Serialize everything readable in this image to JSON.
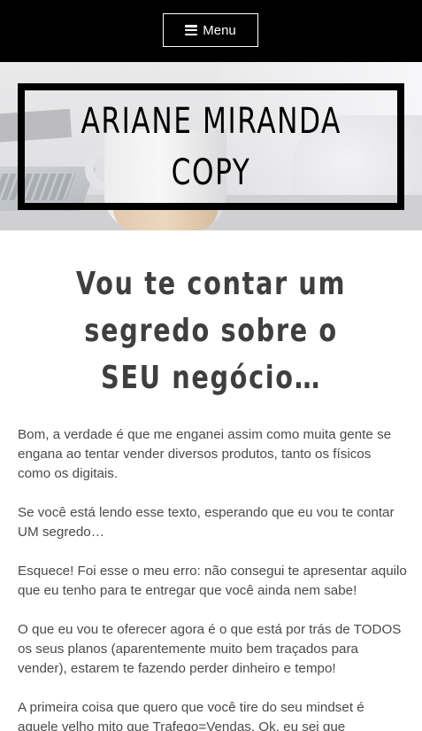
{
  "header": {
    "menu_label": "Menu",
    "menu_icon": "hamburger-menu-icon"
  },
  "hero": {
    "title_line1": "ARIANE MIRANDA",
    "title_line2": "COPY"
  },
  "article": {
    "headline_line1": "Vou te contar um",
    "headline_line2": "segredo sobre o",
    "headline_line3": "SEU negócio…",
    "paragraphs": [
      "Bom, a verdade é que me enganei assim como muita gente se engana ao tentar vender diversos produtos, tanto os físicos como os digitais.",
      "Se você está lendo esse texto, esperando que eu vou te contar UM segredo…",
      "Esquece! Foi esse o meu erro: não consegui te apresentar aquilo que eu tenho para te entregar que você ainda nem sabe!",
      "O que eu vou te oferecer agora é o que está por trás de TODOS os seus planos (aparentemente muito bem traçados para vender), estarem te fazendo perder dinheiro e tempo!",
      "A primeira coisa que quero que você tire do seu mindset é aquele velho mito que Trafego=Vendas. Ok, eu sei que"
    ]
  }
}
